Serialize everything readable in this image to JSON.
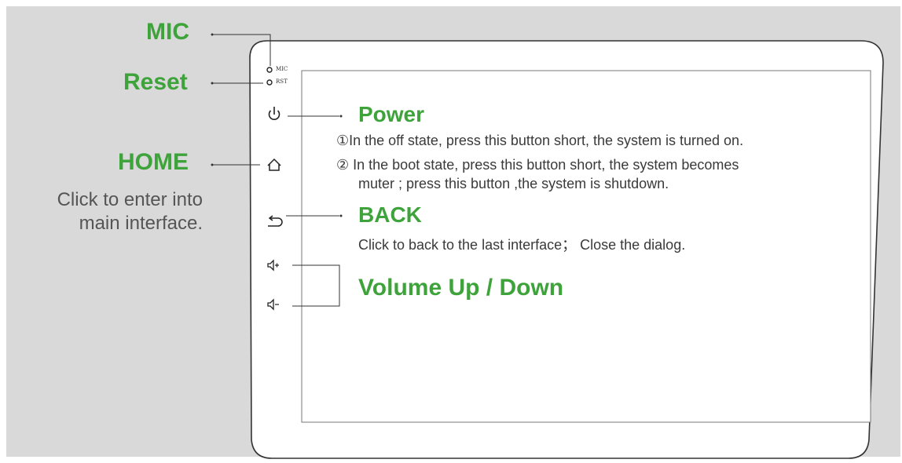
{
  "labels": {
    "mic": "MIC",
    "reset": "Reset",
    "home": "HOME",
    "home_desc": [
      "Click to enter into",
      "main interface."
    ],
    "mic_small": "MIC",
    "reset_small": "RST"
  },
  "sections": {
    "power": {
      "title": "Power",
      "line1": "①In the off state, press this button short, the system is turned on.",
      "line2": "② In the boot state, press this button short, the system becomes",
      "line3": "muter ; press this button ,the system is shutdown."
    },
    "back": {
      "title": "BACK",
      "desc": "Click to back to the last interface；  Close the dialog."
    },
    "volume": {
      "title": "Volume Up / Down"
    }
  },
  "icons": [
    "power-icon",
    "home-icon",
    "back-icon",
    "volume-up-icon",
    "volume-down-icon"
  ],
  "colors": {
    "accent_green": "#3ea33a",
    "background": "#d9d9d9"
  }
}
